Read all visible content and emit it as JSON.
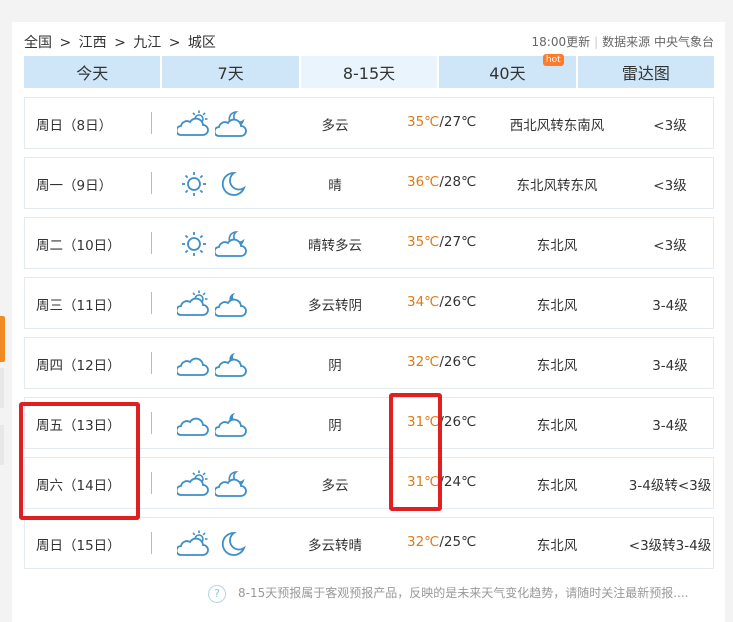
{
  "breadcrumb": {
    "items": [
      "全国",
      "江西",
      "九江",
      "城区"
    ],
    "sep": ">"
  },
  "update": {
    "time": "18:00更新",
    "source": "数据来源 中央气象台",
    "sep": "|"
  },
  "tabs": [
    {
      "label": "今天",
      "active": false
    },
    {
      "label": "7天",
      "active": false
    },
    {
      "label": "8-15天",
      "active": true
    },
    {
      "label": "40天",
      "active": false,
      "badge": "hot"
    },
    {
      "label": "雷达图",
      "active": false
    }
  ],
  "forecast": [
    {
      "day": "周日（8日）",
      "icon1": "partly-cloudy-day-icon",
      "icon2": "cloudy-night-icon",
      "cond": "多云",
      "hi": "35℃",
      "lo": "/27℃",
      "wind": "西北风转东南风",
      "level": "<3级"
    },
    {
      "day": "周一（9日）",
      "icon1": "sun-icon",
      "icon2": "moon-icon",
      "cond": "晴",
      "hi": "36℃",
      "lo": "/28℃",
      "wind": "东北风转东风",
      "level": "<3级"
    },
    {
      "day": "周二（10日）",
      "icon1": "sun-icon",
      "icon2": "cloudy-night-icon",
      "cond": "晴转多云",
      "hi": "35℃",
      "lo": "/27℃",
      "wind": "东北风",
      "level": "<3级"
    },
    {
      "day": "周三（11日）",
      "icon1": "partly-cloudy-day-icon",
      "icon2": "overcast-night-icon",
      "cond": "多云转阴",
      "hi": "34℃",
      "lo": "/26℃",
      "wind": "东北风",
      "level": "3-4级"
    },
    {
      "day": "周四（12日）",
      "icon1": "cloud-icon",
      "icon2": "overcast-night-icon",
      "cond": "阴",
      "hi": "32℃",
      "lo": "/26℃",
      "wind": "东北风",
      "level": "3-4级"
    },
    {
      "day": "周五（13日）",
      "icon1": "cloud-icon",
      "icon2": "overcast-night-icon",
      "cond": "阴",
      "hi": "31℃",
      "lo": "/26℃",
      "wind": "东北风",
      "level": "3-4级"
    },
    {
      "day": "周六（14日）",
      "icon1": "partly-cloudy-day-icon",
      "icon2": "cloudy-night-icon",
      "cond": "多云",
      "hi": "31℃",
      "lo": "/24℃",
      "wind": "东北风",
      "level": "3-4级转<3级"
    },
    {
      "day": "周日（15日）",
      "icon1": "partly-cloudy-day-icon",
      "icon2": "moon-icon",
      "cond": "多云转晴",
      "hi": "32℃",
      "lo": "/25℃",
      "wind": "东北风",
      "level": "<3级转3-4级"
    }
  ],
  "footer": {
    "text": "8-15天预报属于客观预报产品，反映的是未来天气变化趋势，请随时关注最新预报....",
    "icon": "question-icon"
  },
  "colors": {
    "accent": "#e07b16",
    "tab": "#cfe6f8",
    "annotation": "#e02020"
  }
}
